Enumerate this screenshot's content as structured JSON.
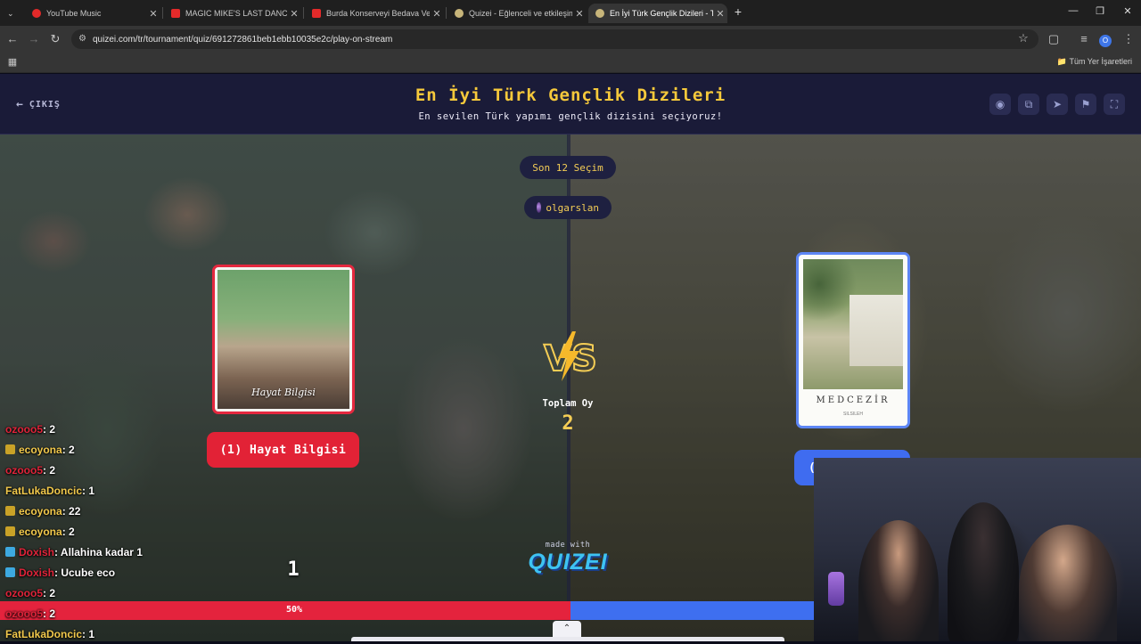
{
  "browser": {
    "tabs": [
      {
        "title": "YouTube Music",
        "fav": "#e32a2a"
      },
      {
        "title": "MAGIC MIKE'S LAST DANCE - B",
        "fav": "#e32a2a"
      },
      {
        "title": "Burda Konserveyi Bedava Verm",
        "fav": "#e32a2a"
      },
      {
        "title": "Quizei - Eğlenceli ve etkileşimli",
        "fav": "#c7b57a"
      },
      {
        "title": "En İyi Türk Gençlik Dizileri - Tie",
        "fav": "#c7b57a"
      }
    ],
    "url": "quizei.com/tr/tournament/quiz/691272861beb1ebb10035e2c/play-on-stream",
    "bookmarks_label": "Tüm Yer İşaretleri",
    "profile_initial": "O"
  },
  "app": {
    "exit_label": "ÇIKIŞ",
    "title": "En İyi Türk Gençlik Dizileri",
    "subtitle": "En sevilen Türk yapımı gençlik dizisini seçiyoruz!",
    "last_picks": "Son 12 Seçim",
    "username": "olgarslan",
    "left": {
      "poster_caption": "Hayat Bilgisi",
      "button_label": "(1) Hayat Bilgisi",
      "votes": "1"
    },
    "right": {
      "logo": "MEDCEZİR",
      "logo_sub": "SILSILEH",
      "button_label": "("
    },
    "total_label": "Toplam Oy",
    "total_value": "2",
    "vote_share_left": 0.5,
    "vote_pct_label": "50%",
    "made_with": "made with",
    "brand": "QUIZEI"
  },
  "colors": {
    "red": "#e4233d",
    "blue": "#3e6ff0",
    "gold": "#f6c93b"
  },
  "chat": [
    {
      "user": "ozooo5",
      "msg": ": 2",
      "color": "#e0243a",
      "badge": ""
    },
    {
      "user": "ecoyona",
      "msg": ": 2",
      "color": "#f2c94c",
      "badge": "#c9a227"
    },
    {
      "user": "ozooo5",
      "msg": ": 2",
      "color": "#e0243a",
      "badge": ""
    },
    {
      "user": "FatLukaDoncic",
      "msg": ": 1",
      "color": "#f2c94c",
      "badge": ""
    },
    {
      "user": "ecoyona",
      "msg": ": 22",
      "color": "#f2c94c",
      "badge": "#c9a227"
    },
    {
      "user": "ecoyona",
      "msg": ": 2",
      "color": "#f2c94c",
      "badge": "#c9a227"
    },
    {
      "user": "Doxish",
      "msg": ": Allahina kadar 1",
      "color": "#e0243a",
      "badge": "#3da9e0"
    },
    {
      "user": "Doxish",
      "msg": ": Ucube eco",
      "color": "#e0243a",
      "badge": "#3da9e0"
    },
    {
      "user": "ozooo5",
      "msg": ": 2",
      "color": "#e0243a",
      "badge": ""
    },
    {
      "user": "ozooo5",
      "msg": ": 2",
      "color": "#e0243a",
      "badge": ""
    },
    {
      "user": "FatLukaDoncic",
      "msg": ": 1",
      "color": "#f2c94c",
      "badge": ""
    }
  ]
}
